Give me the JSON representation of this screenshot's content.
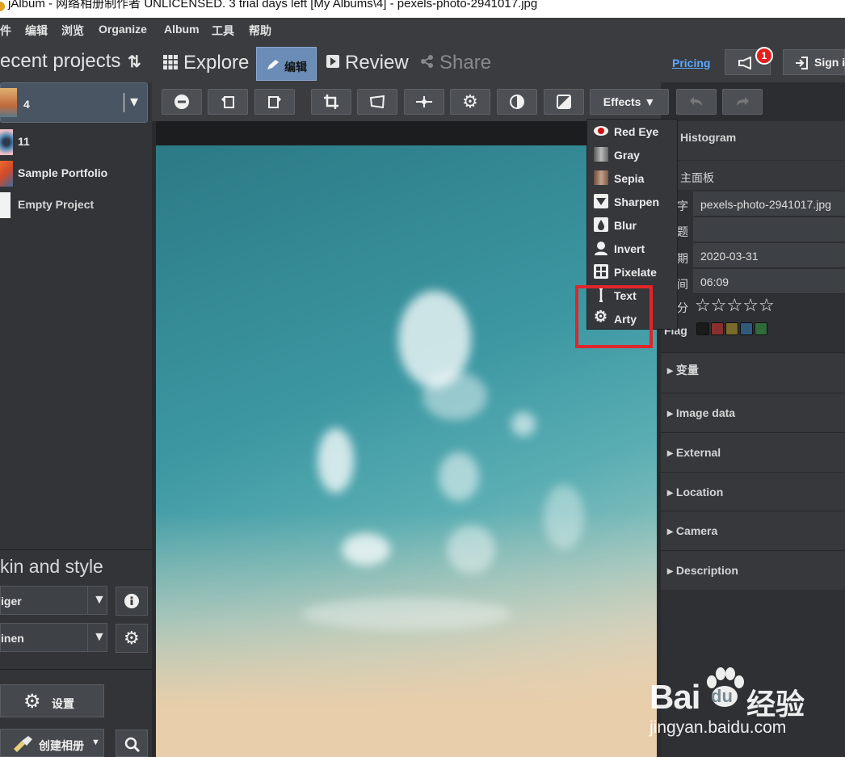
{
  "window": {
    "title": "jAlbum - 网络相册制作者 UNLICENSED. 3 trial days left [My Albums\\4] - pexels-photo-2941017.jpg",
    "minimize_glyph": "—"
  },
  "menubar": {
    "items": [
      "件",
      "编辑",
      "浏览",
      "Organize",
      "Album",
      "工具",
      "帮助"
    ]
  },
  "sidebar": {
    "header": "ecent projects",
    "sort_glyph": "⇅",
    "projects": [
      {
        "label": "4",
        "thumb_color": "#c26a3c"
      },
      {
        "label": "11",
        "thumb_color": "#5d8fb8"
      },
      {
        "label": "Sample Portfolio",
        "thumb_color": "#d24a2a"
      },
      {
        "label": "Empty Project",
        "thumb_color": "#f2f2f2"
      }
    ],
    "selected_dropdown_glyph": "▾",
    "skin_section_title": "kin and style",
    "skin_value": "iger",
    "style_value": "inen",
    "settings_label": "设置",
    "create_album_label": "创建相册"
  },
  "modes": {
    "explore": "Explore",
    "edit": "编辑",
    "review": "Review",
    "share": "Share"
  },
  "header_right": {
    "pricing": "Pricing",
    "notification_count": "1",
    "sign_in": "Sign i"
  },
  "toolbar": {
    "effects_label": "Effects ▼"
  },
  "effects_menu": {
    "items": [
      "Red Eye",
      "Gray",
      "Sepia",
      "Sharpen",
      "Blur",
      "Invert",
      "Pixelate",
      "Text",
      "Arty"
    ]
  },
  "right_panel": {
    "histogram": "Histogram",
    "main_panel": "主面板",
    "fields": [
      {
        "label": "字",
        "value": "pexels-photo-2941017.jpg"
      },
      {
        "label": "题",
        "value": ""
      },
      {
        "label": "期",
        "value": "2020-03-31"
      },
      {
        "label": "间",
        "value": "06:09"
      }
    ],
    "rating_label": "分",
    "rating_value": 0,
    "rating_max": 5,
    "flag_label": "Flag",
    "flag_colors": [
      "#1a1a1a",
      "#8a2f2f",
      "#7a6a2a",
      "#2f5a7a",
      "#2f6a3a"
    ],
    "sections": [
      "变量",
      "Image data",
      "External",
      "Location",
      "Camera",
      "Description"
    ]
  },
  "watermark": {
    "brand": "Bai",
    "brand2": "du",
    "cn": "经验",
    "url": "jingyan.baidu.com"
  }
}
